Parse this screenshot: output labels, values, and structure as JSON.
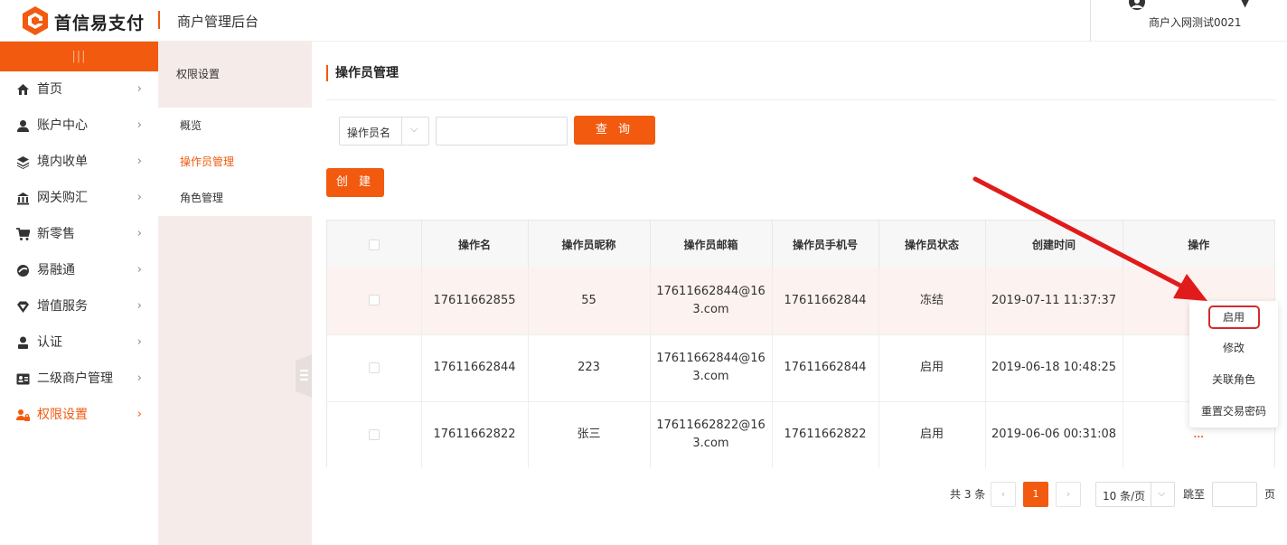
{
  "header": {
    "brand": "首信易支付",
    "subtitle": "商户管理后台",
    "user_name": "商户入网测试0021"
  },
  "sidebar": {
    "toggle_glyph": "|||",
    "items": [
      {
        "label": "首页",
        "icon": "home-icon"
      },
      {
        "label": "账户中心",
        "icon": "user-icon"
      },
      {
        "label": "境内收单",
        "icon": "layers-icon"
      },
      {
        "label": "网关购汇",
        "icon": "bank-icon"
      },
      {
        "label": "新零售",
        "icon": "cart-icon"
      },
      {
        "label": "易融通",
        "icon": "globe-icon"
      },
      {
        "label": "增值服务",
        "icon": "diamond-icon"
      },
      {
        "label": "认证",
        "icon": "person-icon"
      },
      {
        "label": "二级商户管理",
        "icon": "id-card-icon"
      },
      {
        "label": "权限设置",
        "icon": "lock-people-icon",
        "active": true
      }
    ]
  },
  "subnav": {
    "title": "权限设置",
    "items": [
      "概览",
      "操作员管理",
      "角色管理"
    ]
  },
  "main": {
    "page_title": "操作员管理",
    "filter_label": "操作员名",
    "filter_value": "",
    "query_button": "查 询",
    "create_button": "创 建",
    "columns": [
      "操作名",
      "操作员昵称",
      "操作员邮箱",
      "操作员手机号",
      "操作员状态",
      "创建时间",
      "操作"
    ],
    "rows": [
      {
        "name": "17611662855",
        "nickname": "55",
        "email_1": "17611662844@16",
        "email_2": "3.com",
        "phone": "17611662844",
        "status": "冻结",
        "created": "2019-07-11 11:37:37",
        "action": ""
      },
      {
        "name": "17611662844",
        "nickname": "223",
        "email_1": "17611662844@16",
        "email_2": "3.com",
        "phone": "17611662844",
        "status": "启用",
        "created": "2019-06-18 10:48:25",
        "action": ""
      },
      {
        "name": "17611662822",
        "nickname": "张三",
        "email_1": "17611662822@16",
        "email_2": "3.com",
        "phone": "17611662822",
        "status": "启用",
        "created": "2019-06-06 00:31:08",
        "action": "..."
      }
    ]
  },
  "pagination": {
    "total": "共 3 条",
    "prev": "‹",
    "current": "1",
    "next": "›",
    "page_size": "10 条/页",
    "goto_label": "跳至",
    "page_suffix": "页"
  },
  "action_menu": {
    "items": [
      "启用",
      "修改",
      "关联角色",
      "重置交易密码"
    ],
    "highlighted": "启用"
  },
  "colors": {
    "accent": "#f25a0f",
    "highlight_box": "#d52b2b",
    "arrow": "#e11b1b"
  }
}
